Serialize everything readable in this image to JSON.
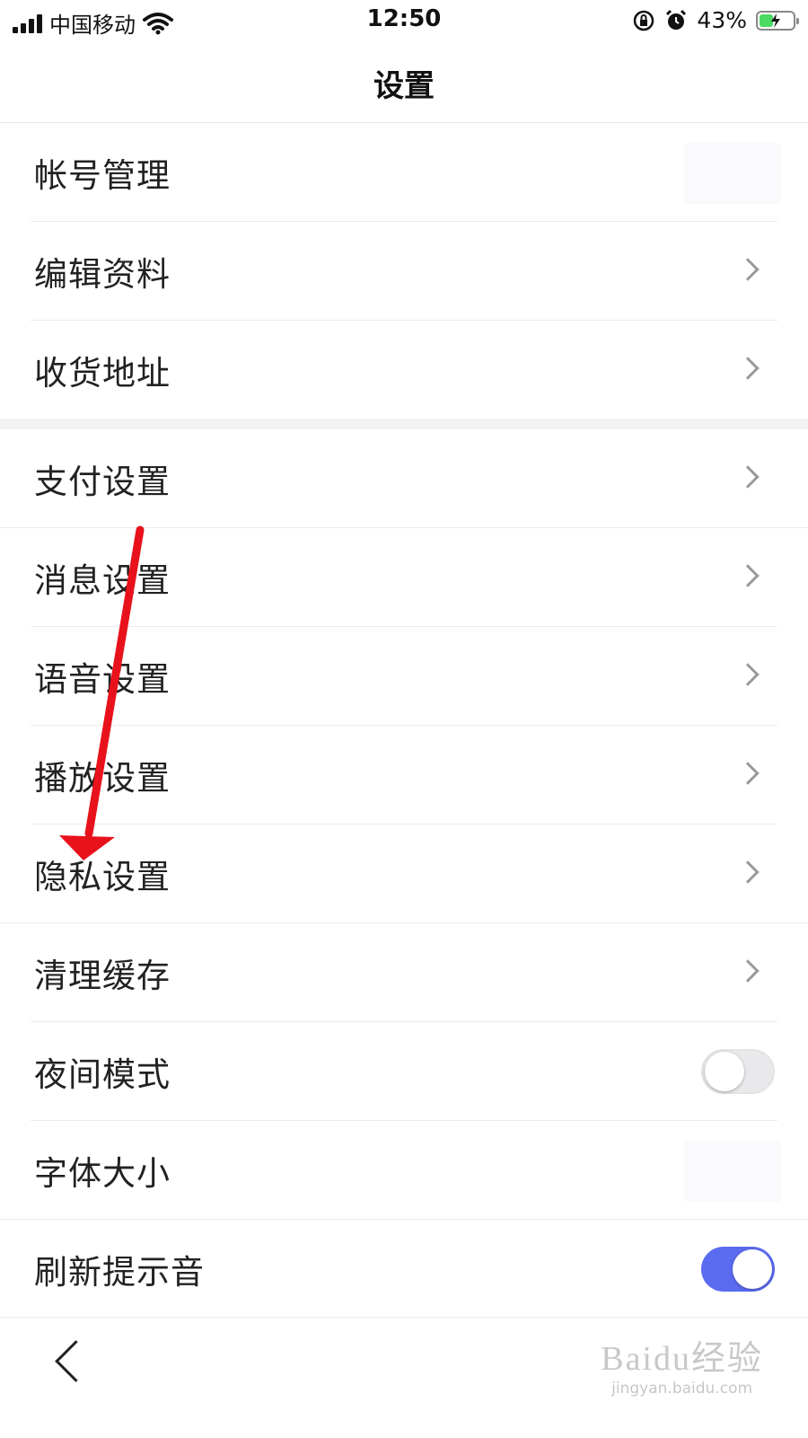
{
  "status_bar": {
    "carrier": "中国移动",
    "time": "12:50",
    "battery_percent_text": "43%",
    "battery_level": 0.43
  },
  "nav": {
    "title": "设置"
  },
  "groups": [
    {
      "items": [
        {
          "label": "帐号管理",
          "control": "blank"
        },
        {
          "label": "编辑资料",
          "control": "chevron"
        },
        {
          "label": "收货地址",
          "control": "chevron"
        }
      ]
    },
    {
      "items": [
        {
          "label": "支付设置",
          "control": "chevron"
        },
        {
          "label": "消息设置",
          "control": "chevron"
        },
        {
          "label": "语音设置",
          "control": "chevron"
        },
        {
          "label": "播放设置",
          "control": "chevron"
        },
        {
          "label": "隐私设置",
          "control": "chevron"
        },
        {
          "label": "清理缓存",
          "control": "chevron"
        },
        {
          "label": "夜间模式",
          "control": "toggle",
          "on": false
        },
        {
          "label": "字体大小",
          "control": "blank"
        },
        {
          "label": "刷新提示音",
          "control": "toggle",
          "on": true
        }
      ]
    }
  ],
  "colors": {
    "toggle_on": "#5a6bf0",
    "annotation_arrow": "#e8121c",
    "battery": "#4cd964"
  },
  "watermark": {
    "main": "Baidu经验",
    "sub": "jingyan.baidu.com"
  }
}
